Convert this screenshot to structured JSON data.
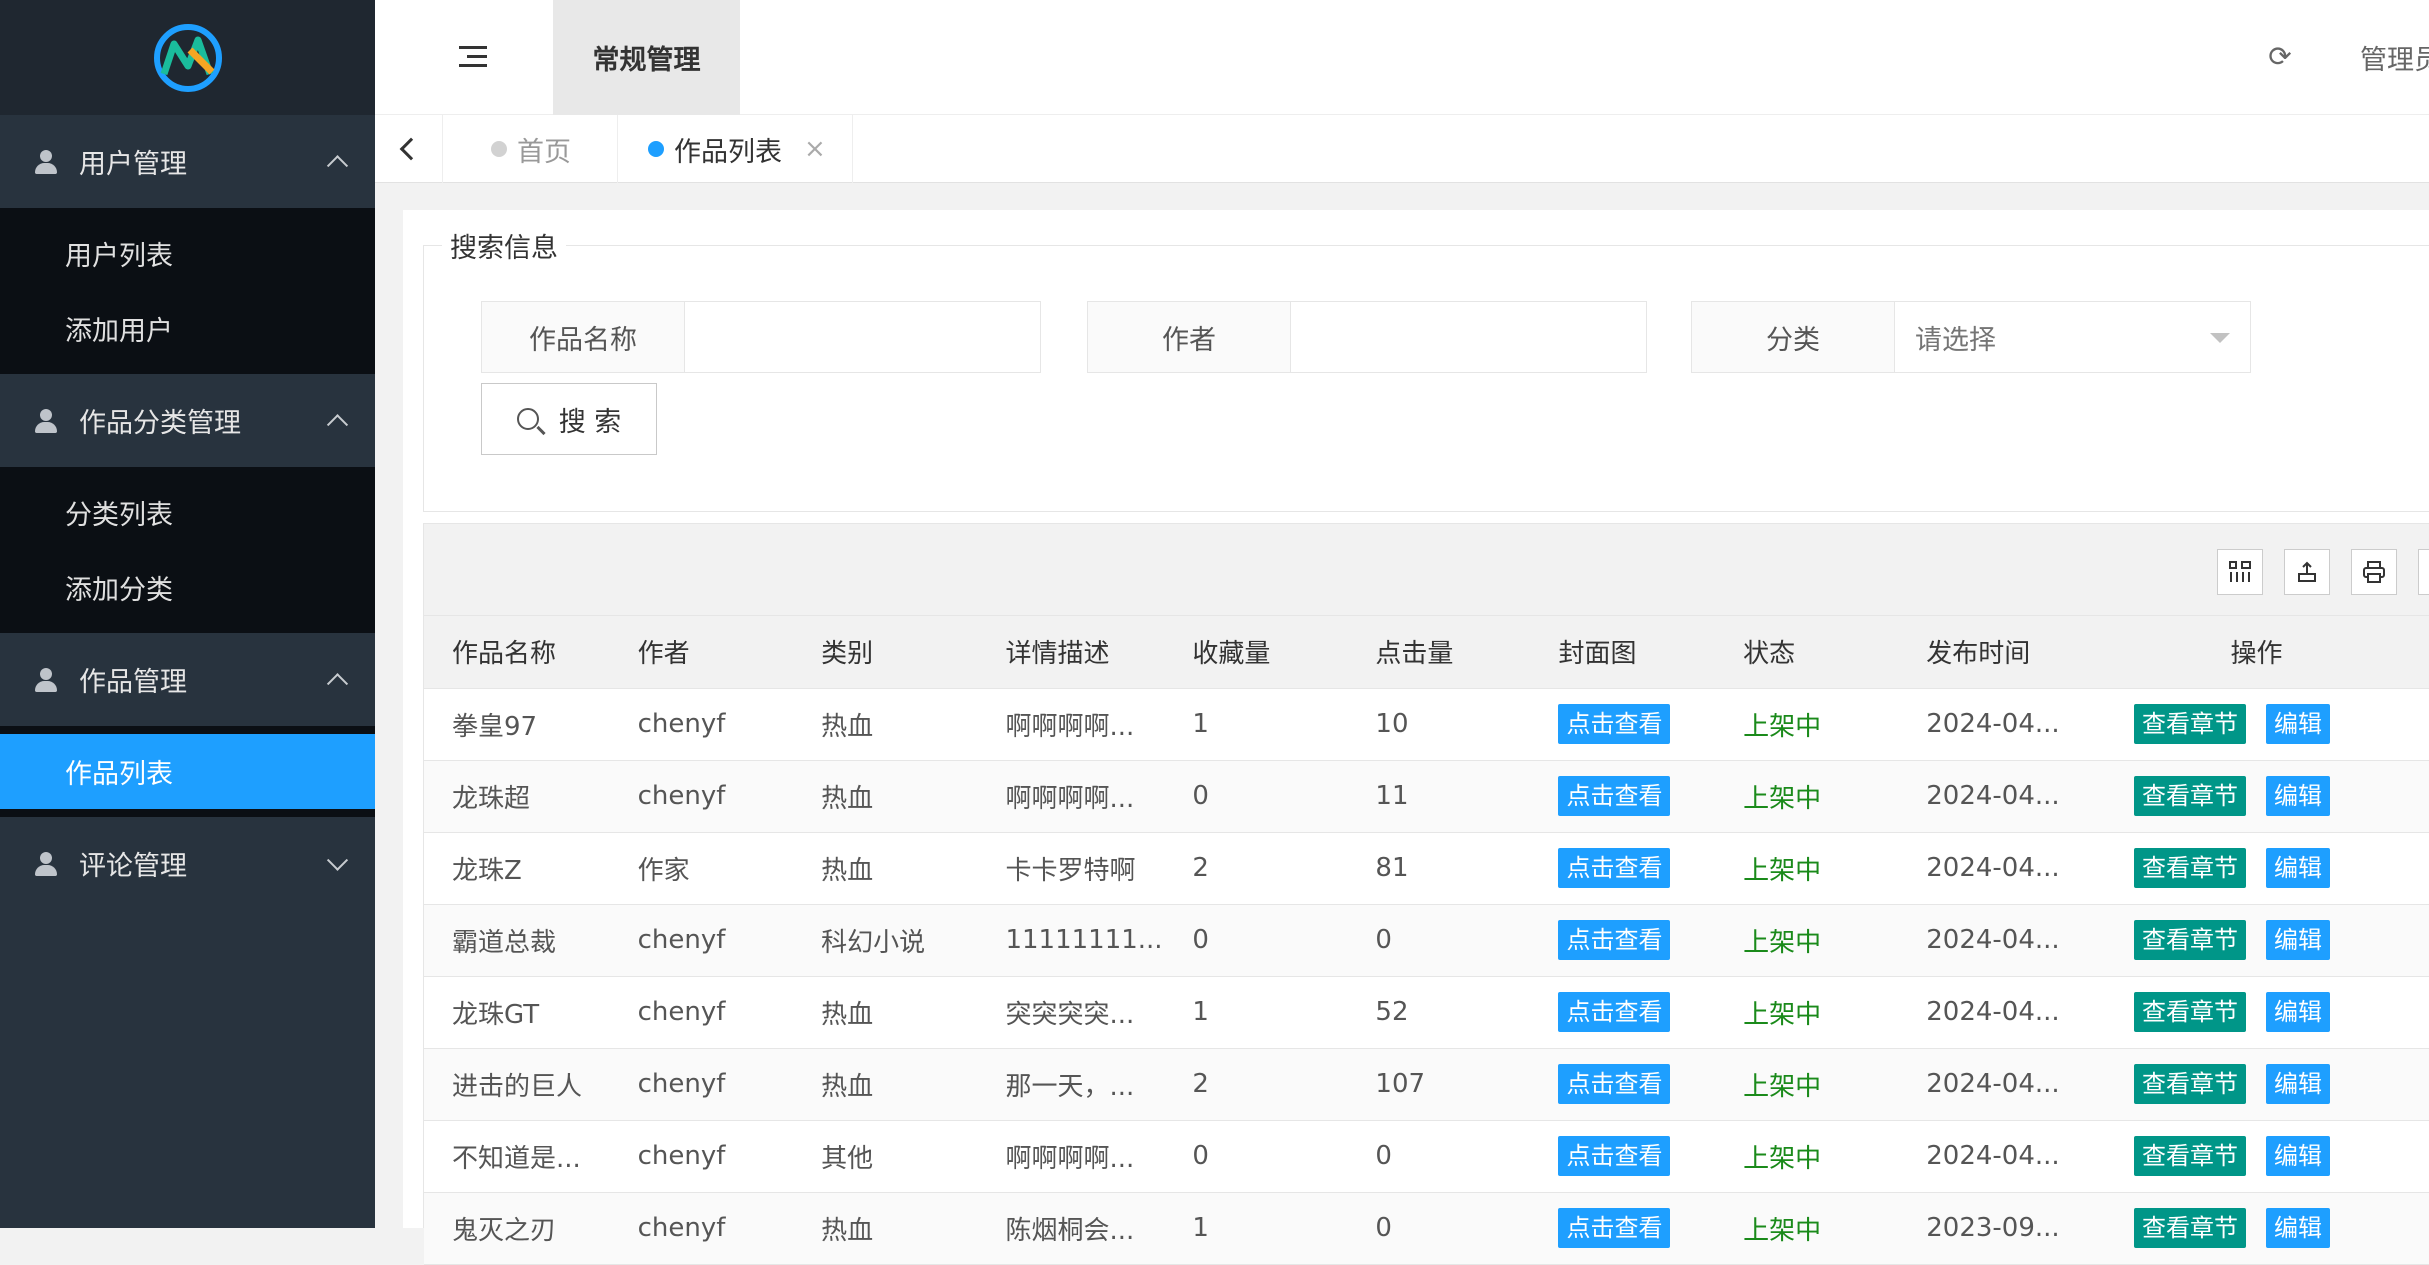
{
  "sidebar": {
    "groups": [
      {
        "label": "用户管理",
        "expanded": true,
        "items": [
          {
            "label": "用户列表"
          },
          {
            "label": "添加用户"
          }
        ]
      },
      {
        "label": "作品分类管理",
        "expanded": true,
        "items": [
          {
            "label": "分类列表"
          },
          {
            "label": "添加分类"
          }
        ]
      },
      {
        "label": "作品管理",
        "expanded": true,
        "items": [
          {
            "label": "作品列表",
            "active": true
          }
        ]
      },
      {
        "label": "评论管理",
        "expanded": false,
        "items": []
      }
    ]
  },
  "header": {
    "module_tab": "常规管理",
    "admin_label": "管理员"
  },
  "tabs": {
    "home": "首页",
    "works": "作品列表",
    "close_glyph": "×"
  },
  "search": {
    "legend": "搜索信息",
    "name_label": "作品名称",
    "author_label": "作者",
    "category_label": "分类",
    "category_placeholder": "请选择",
    "button_label": "搜 索"
  },
  "table": {
    "columns": [
      "作品名称",
      "作者",
      "类别",
      "详情描述",
      "收藏量",
      "点击量",
      "封面图",
      "状态",
      "发布时间",
      "操作"
    ],
    "cover_btn": "点击查看",
    "chapter_btn": "查看章节",
    "edit_btn": "编辑",
    "rows": [
      [
        "拳皇97",
        "chenyf",
        "热血",
        "啊啊啊啊...",
        "1",
        "10",
        "上架中",
        "2024-04..."
      ],
      [
        "龙珠超",
        "chenyf",
        "热血",
        "啊啊啊啊...",
        "0",
        "11",
        "上架中",
        "2024-04..."
      ],
      [
        "龙珠Z",
        "作家",
        "热血",
        "卡卡罗特啊",
        "2",
        "81",
        "上架中",
        "2024-04..."
      ],
      [
        "霸道总裁",
        "chenyf",
        "科幻小说",
        "11111111...",
        "0",
        "0",
        "上架中",
        "2024-04..."
      ],
      [
        "龙珠GT",
        "chenyf",
        "热血",
        "突突突突...",
        "1",
        "52",
        "上架中",
        "2024-04..."
      ],
      [
        "进击的巨人",
        "chenyf",
        "热血",
        "那一天，...",
        "2",
        "107",
        "上架中",
        "2024-04..."
      ],
      [
        "不知道是...",
        "chenyf",
        "其他",
        "啊啊啊啊...",
        "0",
        "0",
        "上架中",
        "2024-04..."
      ],
      [
        "鬼灭之刃",
        "chenyf",
        "热血",
        "陈烟桐会...",
        "1",
        "0",
        "上架中",
        "2023-09..."
      ]
    ]
  },
  "colors": {
    "accent": "#1e9fff",
    "teal": "#009688",
    "status_green": "#1a8a1a",
    "sidebar_bg": "#28333e"
  }
}
